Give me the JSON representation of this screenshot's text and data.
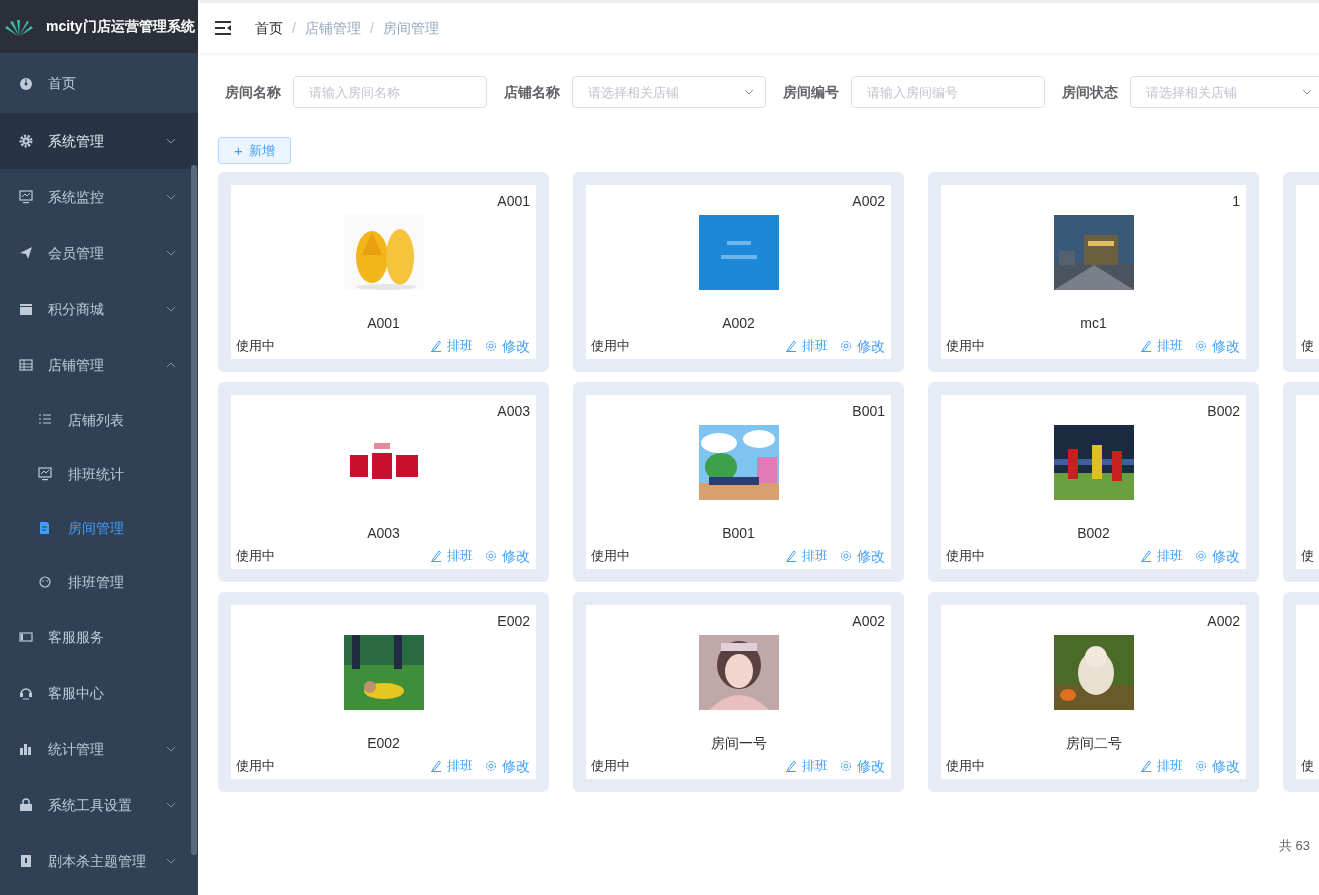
{
  "app": {
    "title": "mcity门店运营管理系统"
  },
  "menu": [
    {
      "label": "首页",
      "hovered": false
    },
    {
      "label": "系统管理",
      "hovered": true,
      "expanded": false
    },
    {
      "label": "系统监控",
      "hovered": false,
      "expanded": false
    },
    {
      "label": "会员管理",
      "hovered": false,
      "expanded": false
    },
    {
      "label": "积分商城",
      "hovered": false,
      "expanded": false
    },
    {
      "label": "店铺管理",
      "hovered": false,
      "expanded": true,
      "children": [
        {
          "label": "店铺列表",
          "selected": false
        },
        {
          "label": "排班统计",
          "selected": false
        },
        {
          "label": "房间管理",
          "selected": true
        },
        {
          "label": "排班管理",
          "selected": false
        }
      ]
    },
    {
      "label": "客服服务",
      "hovered": false
    },
    {
      "label": "客服中心",
      "hovered": false
    },
    {
      "label": "统计管理",
      "hovered": false,
      "expanded": false
    },
    {
      "label": "系统工具设置",
      "hovered": false,
      "expanded": false
    },
    {
      "label": "剧本杀主题管理",
      "hovered": false,
      "expanded": false
    }
  ],
  "breadcrumb": [
    "首页",
    "店铺管理",
    "房间管理"
  ],
  "breadcrumb_separator": "/",
  "filters": [
    {
      "label": "房间名称",
      "kind": "input",
      "placeholder": "请输入房间名称"
    },
    {
      "label": "店铺名称",
      "kind": "select",
      "placeholder": "请选择相关店铺"
    },
    {
      "label": "房间编号",
      "kind": "input",
      "placeholder": "请输入房间编号"
    },
    {
      "label": "房间状态",
      "kind": "select",
      "placeholder": "请选择相关店铺"
    }
  ],
  "add_button": {
    "icon": "+",
    "label": "新增"
  },
  "rooms": [
    {
      "code": "A001",
      "media": {
        "kind": "picture"
      },
      "name": "A001",
      "status": "使用中",
      "actions": [
        "排班",
        "修改"
      ]
    },
    {
      "code": "A002",
      "media": {
        "kind": "picture"
      },
      "name": "A002",
      "status": "使用中",
      "actions": [
        "排班",
        "修改"
      ]
    },
    {
      "code": "1",
      "media": {
        "kind": "picture"
      },
      "name": "mc1",
      "status": "使用中",
      "actions": [
        "排班",
        "修改"
      ]
    },
    {
      "status": "使"
    },
    {
      "code": "A003",
      "media": {
        "kind": "picture"
      },
      "name": "A003",
      "status": "使用中",
      "actions": [
        "排班",
        "修改"
      ]
    },
    {
      "code": "B001",
      "media": {
        "kind": "picture"
      },
      "name": "B001",
      "status": "使用中",
      "actions": [
        "排班",
        "修改"
      ]
    },
    {
      "code": "B002",
      "media": {
        "kind": "picture"
      },
      "name": "B002",
      "status": "使用中",
      "actions": [
        "排班",
        "修改"
      ]
    },
    {
      "status": "使"
    },
    {
      "code": "E002",
      "media": {
        "kind": "picture"
      },
      "name": "E002",
      "status": "使用中",
      "actions": [
        "排班",
        "修改"
      ]
    },
    {
      "code": "A002",
      "media": {
        "kind": "picture"
      },
      "name": "房间一号",
      "status": "使用中",
      "actions": [
        "排班",
        "修改"
      ]
    },
    {
      "code": "A002",
      "media": {
        "kind": "picture"
      },
      "name": "房间二号",
      "status": "使用中",
      "actions": [
        "排班",
        "修改"
      ]
    },
    {
      "status": "使"
    }
  ],
  "pagination": {
    "total": "共 63"
  }
}
